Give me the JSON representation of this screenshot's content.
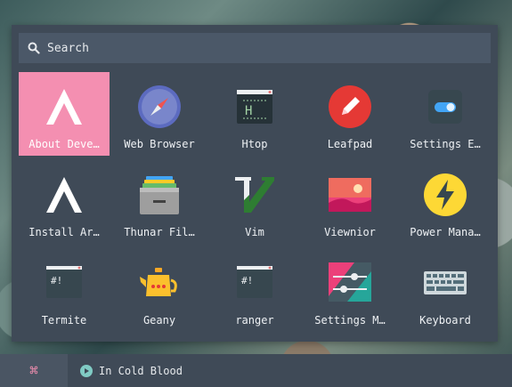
{
  "search": {
    "text": "Search"
  },
  "apps": [
    {
      "label": "About Deve…",
      "icon": "arch-logo-icon",
      "selected": true
    },
    {
      "label": "Web Browser",
      "icon": "compass-browser-icon"
    },
    {
      "label": "Htop",
      "icon": "htop-terminal-icon"
    },
    {
      "label": "Leafpad",
      "icon": "pencil-icon"
    },
    {
      "label": "Settings E…",
      "icon": "toggle-switch-icon"
    },
    {
      "label": "Install Ar…",
      "icon": "arch-logo-icon"
    },
    {
      "label": "Thunar Fil…",
      "icon": "file-manager-icon"
    },
    {
      "label": "Vim",
      "icon": "vim-icon"
    },
    {
      "label": "Viewnior",
      "icon": "image-viewer-icon"
    },
    {
      "label": "Power Mana…",
      "icon": "lightning-icon"
    },
    {
      "label": "Termite",
      "icon": "terminal-icon"
    },
    {
      "label": "Geany",
      "icon": "teapot-icon"
    },
    {
      "label": "ranger",
      "icon": "terminal-icon"
    },
    {
      "label": "Settings M…",
      "icon": "sliders-icon"
    },
    {
      "label": "Keyboard",
      "icon": "keyboard-icon"
    }
  ],
  "taskbar": {
    "menu_glyph": "⌘",
    "now_playing": "In Cold Blood"
  },
  "colors": {
    "accent": "#f48fb1",
    "panel": "#3f4a57",
    "search_bg": "#4b5868"
  }
}
